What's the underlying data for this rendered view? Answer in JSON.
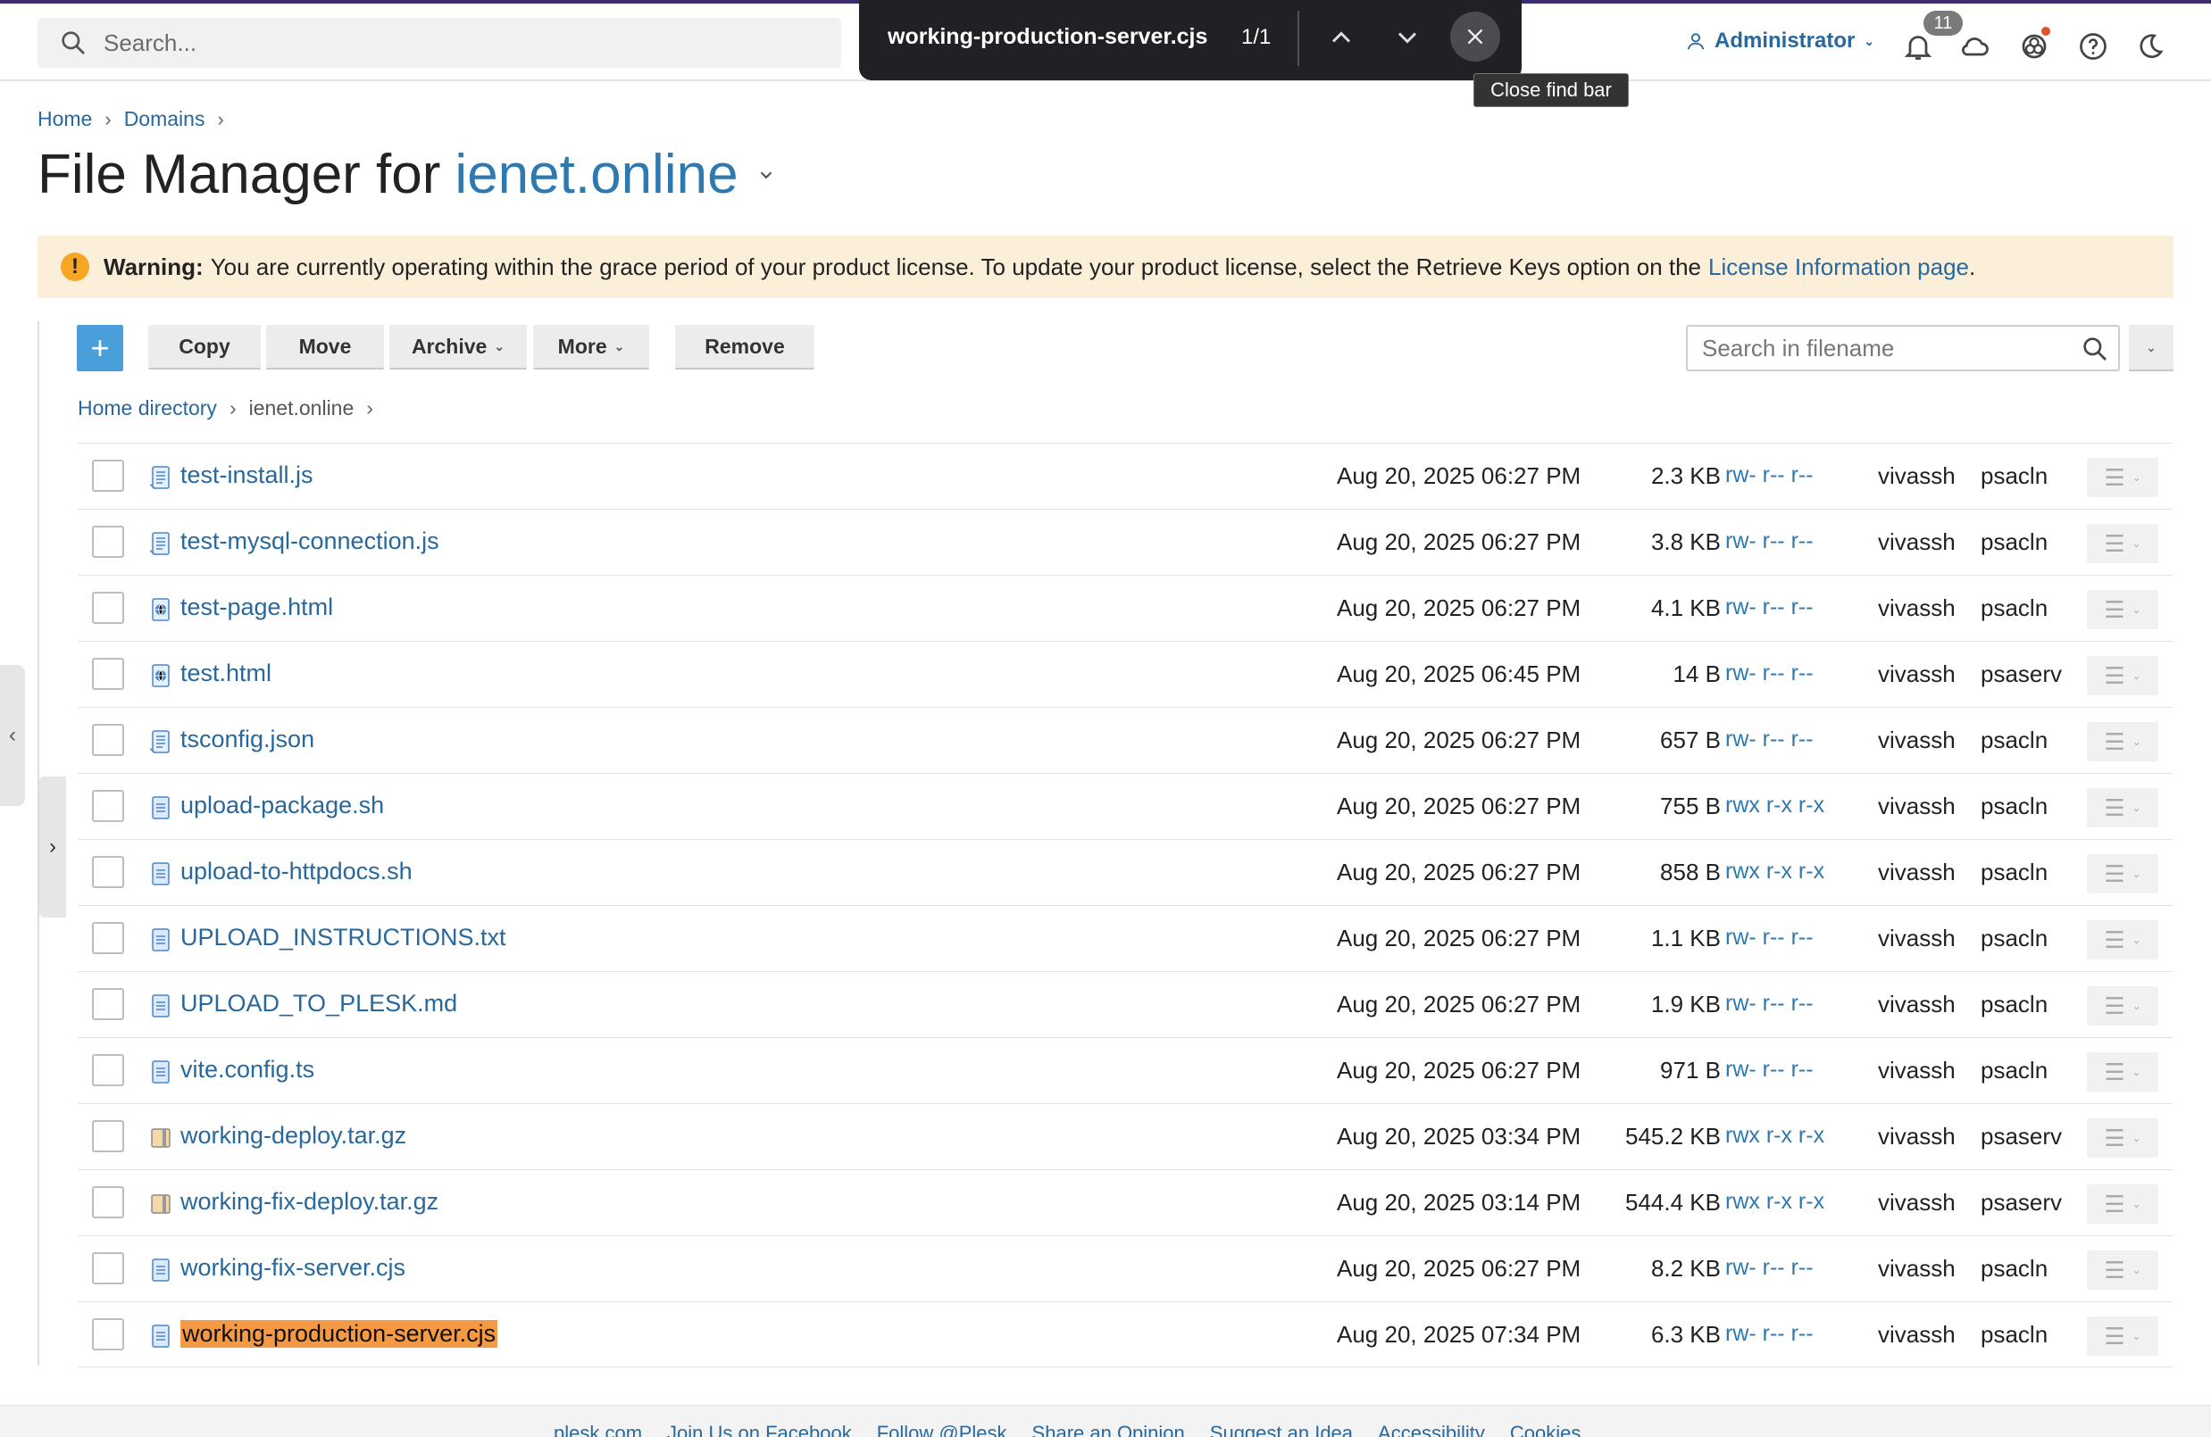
{
  "header": {
    "search_placeholder": "Search...",
    "user_label": "Administrator",
    "notifications_count": "11"
  },
  "findbar": {
    "query": "working-production-server.cjs",
    "count": "1/1",
    "close_tooltip": "Close find bar"
  },
  "breadcrumb": {
    "home": "Home",
    "domains": "Domains"
  },
  "page": {
    "title_prefix": "File Manager for",
    "domain": "ienet.online"
  },
  "warning": {
    "label": "Warning:",
    "text": "You are currently operating within the grace period of your product license. To update your product license, select the Retrieve Keys option on the",
    "link": "License Information page",
    "suffix": "."
  },
  "toolbar": {
    "add_label": "+",
    "copy": "Copy",
    "move": "Move",
    "archive": "Archive",
    "more": "More",
    "remove": "Remove",
    "filename_search_placeholder": "Search in filename"
  },
  "path": {
    "home_dir": "Home directory",
    "current": "ienet.online"
  },
  "files": [
    {
      "name": "test-install.js",
      "date": "Aug 20, 2025 06:27 PM",
      "size": "2.3 KB",
      "perms": "rw- r-- r--",
      "user": "vivassh",
      "group": "psacln",
      "icon": "script-icon"
    },
    {
      "name": "test-mysql-connection.js",
      "date": "Aug 20, 2025 06:27 PM",
      "size": "3.8 KB",
      "perms": "rw- r-- r--",
      "user": "vivassh",
      "group": "psacln",
      "icon": "script-icon"
    },
    {
      "name": "test-page.html",
      "date": "Aug 20, 2025 06:27 PM",
      "size": "4.1 KB",
      "perms": "rw- r-- r--",
      "user": "vivassh",
      "group": "psacln",
      "icon": "html-icon"
    },
    {
      "name": "test.html",
      "date": "Aug 20, 2025 06:45 PM",
      "size": "14 B",
      "perms": "rw- r-- r--",
      "user": "vivassh",
      "group": "psaserv",
      "icon": "html-icon"
    },
    {
      "name": "tsconfig.json",
      "date": "Aug 20, 2025 06:27 PM",
      "size": "657 B",
      "perms": "rw- r-- r--",
      "user": "vivassh",
      "group": "psacln",
      "icon": "script-icon"
    },
    {
      "name": "upload-package.sh",
      "date": "Aug 20, 2025 06:27 PM",
      "size": "755 B",
      "perms": "rwx r-x r-x",
      "user": "vivassh",
      "group": "psacln",
      "icon": "text-file-icon"
    },
    {
      "name": "upload-to-httpdocs.sh",
      "date": "Aug 20, 2025 06:27 PM",
      "size": "858 B",
      "perms": "rwx r-x r-x",
      "user": "vivassh",
      "group": "psacln",
      "icon": "text-file-icon"
    },
    {
      "name": "UPLOAD_INSTRUCTIONS.txt",
      "date": "Aug 20, 2025 06:27 PM",
      "size": "1.1 KB",
      "perms": "rw- r-- r--",
      "user": "vivassh",
      "group": "psacln",
      "icon": "text-file-icon"
    },
    {
      "name": "UPLOAD_TO_PLESK.md",
      "date": "Aug 20, 2025 06:27 PM",
      "size": "1.9 KB",
      "perms": "rw- r-- r--",
      "user": "vivassh",
      "group": "psacln",
      "icon": "text-file-icon"
    },
    {
      "name": "vite.config.ts",
      "date": "Aug 20, 2025 06:27 PM",
      "size": "971 B",
      "perms": "rw- r-- r--",
      "user": "vivassh",
      "group": "psacln",
      "icon": "text-file-icon"
    },
    {
      "name": "working-deploy.tar.gz",
      "date": "Aug 20, 2025 03:34 PM",
      "size": "545.2 KB",
      "perms": "rwx r-x r-x",
      "user": "vivassh",
      "group": "psaserv",
      "icon": "archive-icon"
    },
    {
      "name": "working-fix-deploy.tar.gz",
      "date": "Aug 20, 2025 03:14 PM",
      "size": "544.4 KB",
      "perms": "rwx r-x r-x",
      "user": "vivassh",
      "group": "psaserv",
      "icon": "archive-icon"
    },
    {
      "name": "working-fix-server.cjs",
      "date": "Aug 20, 2025 06:27 PM",
      "size": "8.2 KB",
      "perms": "rw- r-- r--",
      "user": "vivassh",
      "group": "psacln",
      "icon": "text-file-icon"
    },
    {
      "name": "working-production-server.cjs",
      "date": "Aug 20, 2025 07:34 PM",
      "size": "6.3 KB",
      "perms": "rw- r-- r--",
      "user": "vivassh",
      "group": "psacln",
      "icon": "text-file-icon",
      "highlighted": true
    }
  ],
  "footer": {
    "links": [
      "plesk.com",
      "Join Us on Facebook",
      "Follow @Plesk",
      "Share an Opinion",
      "Suggest an Idea",
      "Accessibility",
      "Cookies"
    ]
  },
  "colors": {
    "link": "#28689c",
    "warning_bg": "#fcefd9",
    "highlight": "#f59a44",
    "add_button": "#4a9ed9"
  }
}
